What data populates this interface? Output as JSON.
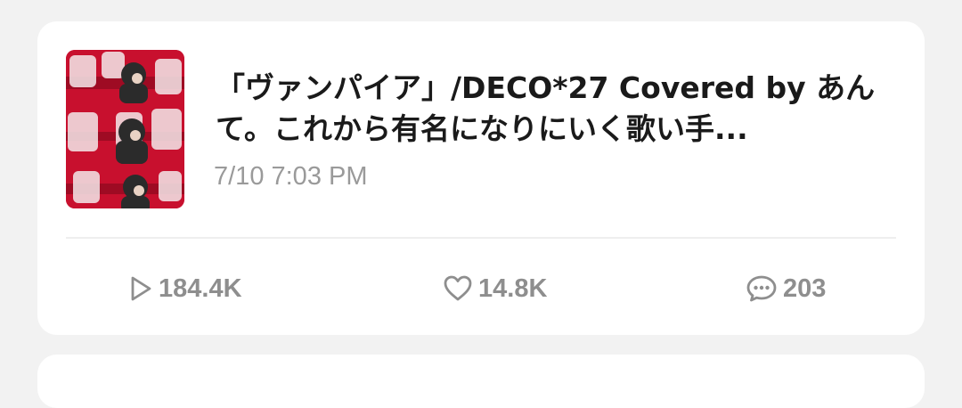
{
  "post": {
    "thumbnail_icon": "video-thumbnail-image",
    "title": "「ヴァンパイア」/DECO*27 Covered by あんて。これから有名になりにいく歌い手...",
    "date": "7/10 7:03 PM"
  },
  "stats": {
    "plays_icon": "play-icon",
    "plays": "184.4K",
    "likes_icon": "heart-icon",
    "likes": "14.8K",
    "comments_icon": "comment-icon",
    "comments": "203"
  },
  "colors": {
    "card_bg": "#ffffff",
    "page_bg": "#f2f2f2",
    "title_text": "#1a1a1a",
    "meta_text": "#9a9a9a",
    "thumbnail_red": "#c8102e"
  }
}
